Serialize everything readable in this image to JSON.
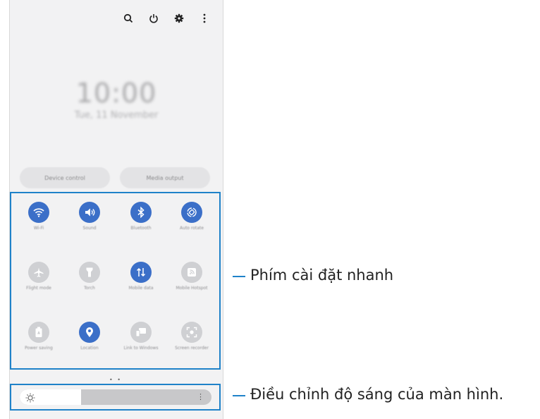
{
  "header": {
    "icons": [
      "search-icon",
      "power-icon",
      "gear-icon",
      "more-vertical-icon"
    ]
  },
  "lock": {
    "time": "10:00",
    "date": "Tue, 11 November"
  },
  "controls": {
    "device_control": "Device control",
    "media_output": "Media output"
  },
  "tiles": [
    {
      "label": "Wi-Fi",
      "icon": "wifi-icon",
      "on": true
    },
    {
      "label": "Sound",
      "icon": "sound-icon",
      "on": true
    },
    {
      "label": "Bluetooth",
      "icon": "bluetooth-icon",
      "on": true
    },
    {
      "label": "Auto rotate",
      "icon": "rotate-icon",
      "on": true
    },
    {
      "label": "Flight mode",
      "icon": "airplane-icon",
      "on": false
    },
    {
      "label": "Torch",
      "icon": "torch-icon",
      "on": false
    },
    {
      "label": "Mobile data",
      "icon": "data-icon",
      "on": true
    },
    {
      "label": "Mobile Hotspot",
      "icon": "hotspot-icon",
      "on": false
    },
    {
      "label": "Power saving",
      "icon": "battery-icon",
      "on": false
    },
    {
      "label": "Location",
      "icon": "location-icon",
      "on": true
    },
    {
      "label": "Link to Windows",
      "icon": "link-windows-icon",
      "on": false
    },
    {
      "label": "Screen recorder",
      "icon": "screen-recorder-icon",
      "on": false
    }
  ],
  "page_dots": "• •",
  "brightness": {
    "level": 0.32,
    "more": "⋮"
  },
  "callouts": {
    "quick_settings": "Phím cài đặt nhanh",
    "brightness": "Điều chỉnh độ sáng của màn hình."
  },
  "colors": {
    "accent": "#3b6fc8",
    "frame": "#1f82c9",
    "off": "#cfd0d3"
  }
}
